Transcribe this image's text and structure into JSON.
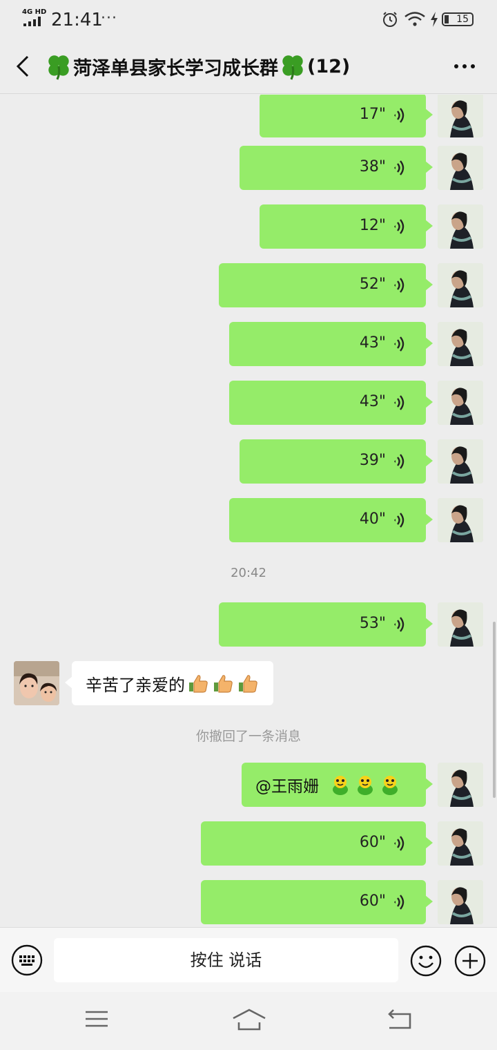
{
  "status_bar": {
    "network": "4G HD",
    "time": "21:41",
    "more": "···",
    "battery": "15"
  },
  "header": {
    "title": "菏泽单县家长学习成长群",
    "member_count": "(12)"
  },
  "messages": [
    {
      "type": "voice",
      "side": "right",
      "duration": "17\""
    },
    {
      "type": "voice",
      "side": "right",
      "duration": "38\""
    },
    {
      "type": "voice",
      "side": "right",
      "duration": "12\""
    },
    {
      "type": "voice",
      "side": "right",
      "duration": "52\""
    },
    {
      "type": "voice",
      "side": "right",
      "duration": "43\""
    },
    {
      "type": "voice",
      "side": "right",
      "duration": "43\""
    },
    {
      "type": "voice",
      "side": "right",
      "duration": "39\""
    },
    {
      "type": "voice",
      "side": "right",
      "duration": "40\""
    },
    {
      "type": "time",
      "text": "20:42"
    },
    {
      "type": "voice",
      "side": "right",
      "duration": "53\""
    },
    {
      "type": "text",
      "side": "left",
      "text": "辛苦了亲爱的",
      "emoji": "thumbs-up x3"
    },
    {
      "type": "system",
      "text": "你撤回了一条消息"
    },
    {
      "type": "text",
      "side": "right",
      "text": "@王雨姗",
      "emoji": "frog x3"
    },
    {
      "type": "voice",
      "side": "right",
      "duration": "60\""
    },
    {
      "type": "voice",
      "side": "right",
      "duration": "60\""
    }
  ],
  "input": {
    "hold_to_talk": "按住 说话"
  },
  "colors": {
    "bubble_green": "#95ec69",
    "background": "#ededed"
  }
}
